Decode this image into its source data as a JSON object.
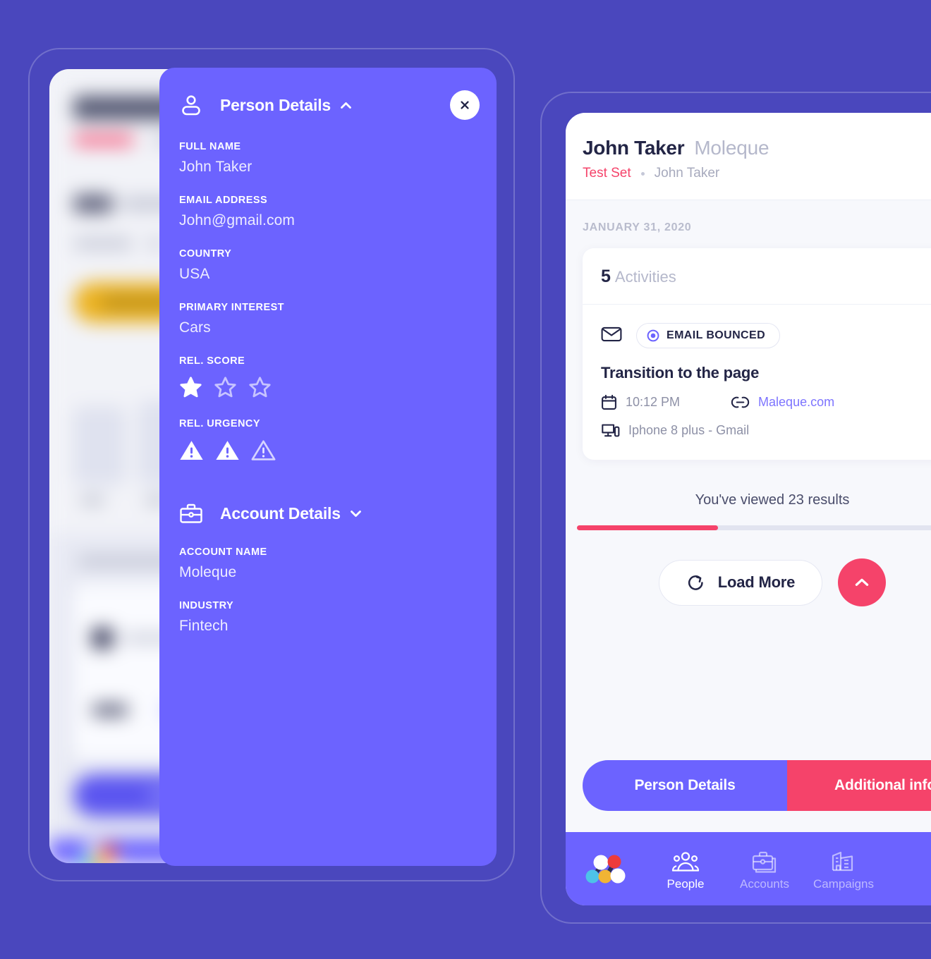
{
  "panel": {
    "header": {
      "title": "Person Details",
      "icon": "person-icon",
      "chevron": "chevron-up-icon",
      "close": "close-icon"
    },
    "fields": [
      {
        "label": "FULL NAME",
        "value": "John Taker"
      },
      {
        "label": "EMAIL ADDRESS",
        "value": "John@gmail.com"
      },
      {
        "label": "COUNTRY",
        "value": "USA"
      },
      {
        "label": "PRIMARY INTEREST",
        "value": "Cars"
      }
    ],
    "score": {
      "label": "REL. SCORE",
      "filled": 1,
      "total": 3
    },
    "urgency": {
      "label": "REL. URGENCY",
      "filled": 2,
      "total": 3
    },
    "account_section": {
      "title": "Account Details",
      "icon": "briefcase-icon",
      "chevron": "chevron-down-icon",
      "fields": [
        {
          "label": "ACCOUNT NAME",
          "value": "Moleque"
        },
        {
          "label": "INDUSTRY",
          "value": "Fintech"
        }
      ]
    }
  },
  "right": {
    "header": {
      "name": "John Taker",
      "account": "Moleque",
      "test_set": "Test Set",
      "owner": "John Taker",
      "menu": "kebab-menu-icon"
    },
    "date_label": "JANUARY 31, 2020",
    "activities": {
      "count": "5",
      "count_label": "Activities",
      "items": [
        {
          "type_icon": "envelope-icon",
          "badge": "EMAIL BOUNCED",
          "title": "Transition to the page",
          "time": "10:12 PM",
          "link": "Maleque.com",
          "device": "Iphone 8 plus - Gmail"
        }
      ]
    },
    "results_text": "You've viewed 23 results",
    "progress_percent": 35,
    "load_more": "Load More",
    "scroll_top_icon": "chevron-up-icon",
    "tabs": [
      {
        "label": "Person Details",
        "active": true
      },
      {
        "label": "Additional info",
        "active": false
      }
    ],
    "nav": {
      "logo": "molecule-logo",
      "items": [
        {
          "label": "People",
          "icon": "people-icon",
          "active": true
        },
        {
          "label": "Accounts",
          "icon": "briefcase-icon",
          "active": false
        },
        {
          "label": "Campaigns",
          "icon": "building-icon",
          "active": false
        }
      ]
    }
  },
  "colors": {
    "background": "#4a47bd",
    "panel_purple": "#6c63ff",
    "accent_pink": "#f5436a",
    "dark_text": "#232546",
    "muted_text": "#b5b8cb"
  }
}
